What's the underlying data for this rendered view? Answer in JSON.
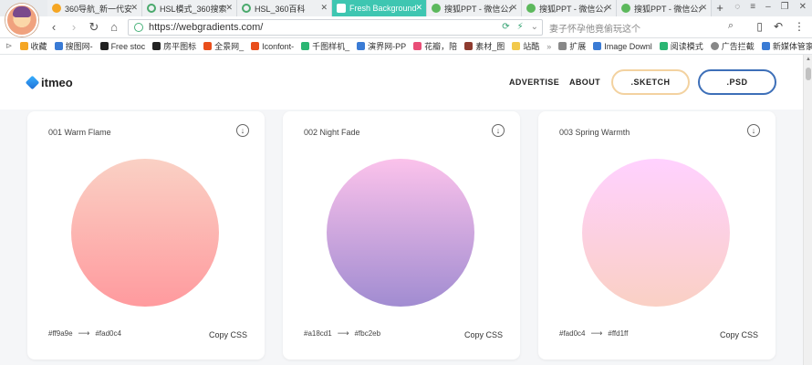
{
  "browser": {
    "tabs": [
      {
        "label": "360导航_新一代安",
        "color": "#f5a623",
        "active": false
      },
      {
        "label": "HSL模式_360搜索",
        "color": "#4aa96c",
        "active": false
      },
      {
        "label": "HSL_360百科",
        "color": "#4aa96c",
        "active": false
      },
      {
        "label": "Fresh Backgrounds",
        "color": "#ffffff",
        "active": true
      },
      {
        "label": "搜狐PPT - 微信公众",
        "color": "#5cb85c",
        "active": false
      },
      {
        "label": "搜狐PPT - 微信公众",
        "color": "#5cb85c",
        "active": false
      },
      {
        "label": "搜狐PPT - 微信公众",
        "color": "#5cb85c",
        "active": false
      }
    ],
    "new_tab": "+",
    "url": "https://webgradients.com/",
    "search_placeholder": "妻子怀孕他竟偷玩这个",
    "bookmarks": [
      {
        "label": "收藏",
        "color": "#f5a623"
      },
      {
        "label": "搜图网-",
        "color": "#3a7bd5"
      },
      {
        "label": "Free stoc",
        "color": "#222222"
      },
      {
        "label": "房平图标",
        "color": "#222222"
      },
      {
        "label": "全景网_",
        "color": "#e94e1b"
      },
      {
        "label": "Iconfont-",
        "color": "#e94e1b"
      },
      {
        "label": "千图样机_",
        "color": "#2bb673"
      },
      {
        "label": "演界网-PP",
        "color": "#3a7bd5"
      },
      {
        "label": "花瓣，陪",
        "color": "#e94e77"
      },
      {
        "label": "素材_图",
        "color": "#8e3b2f"
      },
      {
        "label": "站酷",
        "color": "#f2c94c"
      },
      {
        "label": "»",
        "color": ""
      },
      {
        "label": "扩展",
        "color": "#888888"
      },
      {
        "label": "Image Downl",
        "color": "#3a7bd5"
      },
      {
        "label": "阅读模式",
        "color": "#2bb673"
      },
      {
        "label": "广告拦截",
        "color": "#888888"
      },
      {
        "label": "新媒体管家",
        "color": "#3a7bd5"
      }
    ]
  },
  "site": {
    "logo": "itmeo",
    "nav": {
      "advertise": "ADVERTISE",
      "about": "ABOUT",
      "sketch": ".SKETCH",
      "psd": ".PSD"
    },
    "cards": [
      {
        "title": "001 Warm Flame",
        "from": "#ff9a9e",
        "to": "#fad0c4",
        "from_label": "#ff9a9e",
        "to_label": "#fad0c4",
        "copy": "Copy CSS",
        "download_icon": "download-icon"
      },
      {
        "title": "002 Night Fade",
        "from": "#a18cd1",
        "to": "#fbc2eb",
        "from_label": "#a18cd1",
        "to_label": "#fbc2eb",
        "copy": "Copy CSS",
        "download_icon": "download-icon"
      },
      {
        "title": "003 Spring Warmth",
        "from": "#fad0c4",
        "to": "#ffd1ff",
        "from_label": "#fad0c4",
        "to_label": "#ffd1ff",
        "copy": "Copy CSS",
        "download_icon": "download-icon"
      }
    ]
  }
}
